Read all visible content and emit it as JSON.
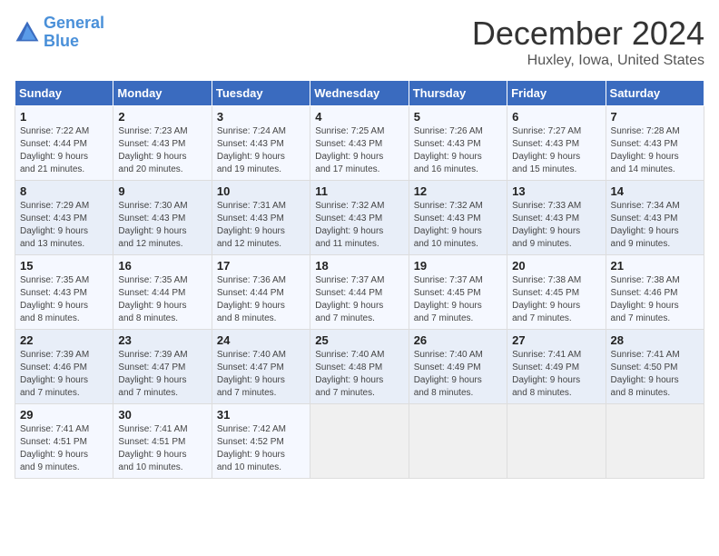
{
  "logo": {
    "line1": "General",
    "line2": "Blue"
  },
  "title": "December 2024",
  "subtitle": "Huxley, Iowa, United States",
  "days_of_week": [
    "Sunday",
    "Monday",
    "Tuesday",
    "Wednesday",
    "Thursday",
    "Friday",
    "Saturday"
  ],
  "weeks": [
    [
      {
        "day": 1,
        "lines": [
          "Sunrise: 7:22 AM",
          "Sunset: 4:44 PM",
          "Daylight: 9 hours",
          "and 21 minutes."
        ]
      },
      {
        "day": 2,
        "lines": [
          "Sunrise: 7:23 AM",
          "Sunset: 4:43 PM",
          "Daylight: 9 hours",
          "and 20 minutes."
        ]
      },
      {
        "day": 3,
        "lines": [
          "Sunrise: 7:24 AM",
          "Sunset: 4:43 PM",
          "Daylight: 9 hours",
          "and 19 minutes."
        ]
      },
      {
        "day": 4,
        "lines": [
          "Sunrise: 7:25 AM",
          "Sunset: 4:43 PM",
          "Daylight: 9 hours",
          "and 17 minutes."
        ]
      },
      {
        "day": 5,
        "lines": [
          "Sunrise: 7:26 AM",
          "Sunset: 4:43 PM",
          "Daylight: 9 hours",
          "and 16 minutes."
        ]
      },
      {
        "day": 6,
        "lines": [
          "Sunrise: 7:27 AM",
          "Sunset: 4:43 PM",
          "Daylight: 9 hours",
          "and 15 minutes."
        ]
      },
      {
        "day": 7,
        "lines": [
          "Sunrise: 7:28 AM",
          "Sunset: 4:43 PM",
          "Daylight: 9 hours",
          "and 14 minutes."
        ]
      }
    ],
    [
      {
        "day": 8,
        "lines": [
          "Sunrise: 7:29 AM",
          "Sunset: 4:43 PM",
          "Daylight: 9 hours",
          "and 13 minutes."
        ]
      },
      {
        "day": 9,
        "lines": [
          "Sunrise: 7:30 AM",
          "Sunset: 4:43 PM",
          "Daylight: 9 hours",
          "and 12 minutes."
        ]
      },
      {
        "day": 10,
        "lines": [
          "Sunrise: 7:31 AM",
          "Sunset: 4:43 PM",
          "Daylight: 9 hours",
          "and 12 minutes."
        ]
      },
      {
        "day": 11,
        "lines": [
          "Sunrise: 7:32 AM",
          "Sunset: 4:43 PM",
          "Daylight: 9 hours",
          "and 11 minutes."
        ]
      },
      {
        "day": 12,
        "lines": [
          "Sunrise: 7:32 AM",
          "Sunset: 4:43 PM",
          "Daylight: 9 hours",
          "and 10 minutes."
        ]
      },
      {
        "day": 13,
        "lines": [
          "Sunrise: 7:33 AM",
          "Sunset: 4:43 PM",
          "Daylight: 9 hours",
          "and 9 minutes."
        ]
      },
      {
        "day": 14,
        "lines": [
          "Sunrise: 7:34 AM",
          "Sunset: 4:43 PM",
          "Daylight: 9 hours",
          "and 9 minutes."
        ]
      }
    ],
    [
      {
        "day": 15,
        "lines": [
          "Sunrise: 7:35 AM",
          "Sunset: 4:43 PM",
          "Daylight: 9 hours",
          "and 8 minutes."
        ]
      },
      {
        "day": 16,
        "lines": [
          "Sunrise: 7:35 AM",
          "Sunset: 4:44 PM",
          "Daylight: 9 hours",
          "and 8 minutes."
        ]
      },
      {
        "day": 17,
        "lines": [
          "Sunrise: 7:36 AM",
          "Sunset: 4:44 PM",
          "Daylight: 9 hours",
          "and 8 minutes."
        ]
      },
      {
        "day": 18,
        "lines": [
          "Sunrise: 7:37 AM",
          "Sunset: 4:44 PM",
          "Daylight: 9 hours",
          "and 7 minutes."
        ]
      },
      {
        "day": 19,
        "lines": [
          "Sunrise: 7:37 AM",
          "Sunset: 4:45 PM",
          "Daylight: 9 hours",
          "and 7 minutes."
        ]
      },
      {
        "day": 20,
        "lines": [
          "Sunrise: 7:38 AM",
          "Sunset: 4:45 PM",
          "Daylight: 9 hours",
          "and 7 minutes."
        ]
      },
      {
        "day": 21,
        "lines": [
          "Sunrise: 7:38 AM",
          "Sunset: 4:46 PM",
          "Daylight: 9 hours",
          "and 7 minutes."
        ]
      }
    ],
    [
      {
        "day": 22,
        "lines": [
          "Sunrise: 7:39 AM",
          "Sunset: 4:46 PM",
          "Daylight: 9 hours",
          "and 7 minutes."
        ]
      },
      {
        "day": 23,
        "lines": [
          "Sunrise: 7:39 AM",
          "Sunset: 4:47 PM",
          "Daylight: 9 hours",
          "and 7 minutes."
        ]
      },
      {
        "day": 24,
        "lines": [
          "Sunrise: 7:40 AM",
          "Sunset: 4:47 PM",
          "Daylight: 9 hours",
          "and 7 minutes."
        ]
      },
      {
        "day": 25,
        "lines": [
          "Sunrise: 7:40 AM",
          "Sunset: 4:48 PM",
          "Daylight: 9 hours",
          "and 7 minutes."
        ]
      },
      {
        "day": 26,
        "lines": [
          "Sunrise: 7:40 AM",
          "Sunset: 4:49 PM",
          "Daylight: 9 hours",
          "and 8 minutes."
        ]
      },
      {
        "day": 27,
        "lines": [
          "Sunrise: 7:41 AM",
          "Sunset: 4:49 PM",
          "Daylight: 9 hours",
          "and 8 minutes."
        ]
      },
      {
        "day": 28,
        "lines": [
          "Sunrise: 7:41 AM",
          "Sunset: 4:50 PM",
          "Daylight: 9 hours",
          "and 8 minutes."
        ]
      }
    ],
    [
      {
        "day": 29,
        "lines": [
          "Sunrise: 7:41 AM",
          "Sunset: 4:51 PM",
          "Daylight: 9 hours",
          "and 9 minutes."
        ]
      },
      {
        "day": 30,
        "lines": [
          "Sunrise: 7:41 AM",
          "Sunset: 4:51 PM",
          "Daylight: 9 hours",
          "and 10 minutes."
        ]
      },
      {
        "day": 31,
        "lines": [
          "Sunrise: 7:42 AM",
          "Sunset: 4:52 PM",
          "Daylight: 9 hours",
          "and 10 minutes."
        ]
      },
      null,
      null,
      null,
      null
    ]
  ]
}
